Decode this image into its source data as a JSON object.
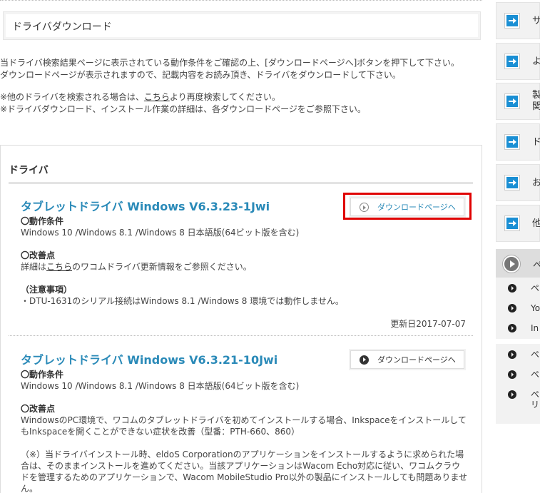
{
  "page": {
    "title": "ドライバダウンロード",
    "intro_lines": [
      "当ドライバ検索結果ページに表示されている動作条件をご確認の上、[ダウンロードページへ]ボタンを押下して下さい。",
      "ダウンロードページが表示されますので、記載内容をお読み頂き、ドライバをダウンロードして下さい。"
    ],
    "note1_prefix": "※他のドライバを検索される場合は、",
    "note1_link": "こちら",
    "note1_suffix": "より再度検索してください。",
    "note2": "※ドライバダウンロード、インストール作業の詳細は、各ダウンロードページをご参照下さい。"
  },
  "panel": {
    "heading": "ドライバ",
    "items": [
      {
        "title": "タブレットドライバ Windows V6.3.23-1Jwi",
        "button_label": "ダウンロードページへ",
        "req_head": "〇動作条件",
        "req_text": "Windows 10 /Windows 8.1 /Windows 8 日本語版(64ビット版を含む)",
        "imp_head": "〇改善点",
        "imp_prefix": "詳細は",
        "imp_link": "こちら",
        "imp_suffix": "のワコムドライバ更新情報をご参照ください。",
        "caution_head": "（注意事項）",
        "caution_text": "・DTU-1631のシリアル接続はWindows 8.1 /Windows 8 環境では動作しません。",
        "updated": "更新日2017-07-07"
      },
      {
        "title": "タブレットドライバ Windows V6.3.21-10Jwi",
        "button_label": "ダウンロードページへ",
        "req_head": "〇動作条件",
        "req_text": "Windows 10 /Windows 8.1 /Windows 8 日本語版(64ビット版を含む)",
        "imp_head": "〇改善点",
        "imp_line1": "WindowsのPC環境で、ワコムのタブレットドライバを初めてインストールする場合、Inkspaceをインストールして",
        "imp_line2": "もInkspaceを開くことができない症状を改善（型番：PTH-660、860）",
        "note_line1": "（※）当ドライバインストール時、eldoS Corporationのアプリケーションをインストールするように求められた場",
        "note_line2": "合は、そのままインストールを進めてください。当該アプリケーションはWacom Echo対応に従い、ワコムクラウ",
        "note_line3": "ドを管理するためのアプリケーションで、Wacom MobileStudio Pro以外の製品にインストールしても問題ありませ",
        "note_line4": "ん。"
      }
    ]
  },
  "sidebar": {
    "items": [
      {
        "label": "サ"
      },
      {
        "label": "よ"
      },
      {
        "label": "製",
        "label2": "関"
      },
      {
        "label": "ド"
      },
      {
        "label": "お"
      },
      {
        "label": "他"
      }
    ],
    "head_label": "ペ",
    "sub_group1": [
      {
        "label": "ペ"
      },
      {
        "label": "Yo"
      },
      {
        "label": "In"
      }
    ],
    "sub_group2": [
      {
        "label": "ペ"
      },
      {
        "label": "ペ"
      },
      {
        "label": "ペ",
        "label2": "リ"
      }
    ]
  },
  "colors": {
    "accent_blue": "#2a8ab8",
    "sidebar_icon_blue": "#1a8fd4",
    "highlight_red": "#e00000"
  }
}
